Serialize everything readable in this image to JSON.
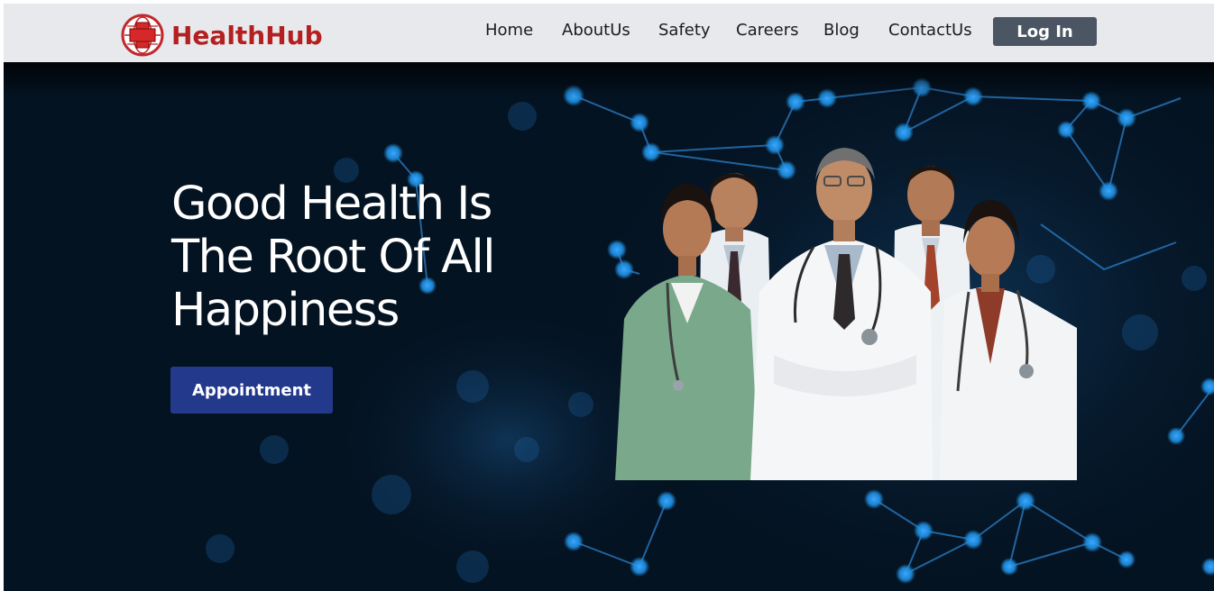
{
  "brand": {
    "name": "HealthHub",
    "logo_icon": "medical-cross-globe-icon",
    "color": "#b41f1f"
  },
  "nav": {
    "items": [
      {
        "label": "Home"
      },
      {
        "label": "AboutUs"
      },
      {
        "label": "Safety"
      },
      {
        "label": "Careers"
      },
      {
        "label": "Blog"
      },
      {
        "label": "ContactUs"
      }
    ],
    "login_label": "Log In"
  },
  "hero": {
    "headline_lines": [
      "Good Health Is",
      "The Root Of All",
      "Happiness"
    ],
    "cta_label": "Appointment",
    "cta_color": "#233a8c",
    "background_color": "#041322",
    "image": "team-of-doctors-photo"
  },
  "colors": {
    "navbar_bg": "#e8e9ec",
    "login_bg": "#4b5563",
    "network_node": "#1f8fe0"
  }
}
